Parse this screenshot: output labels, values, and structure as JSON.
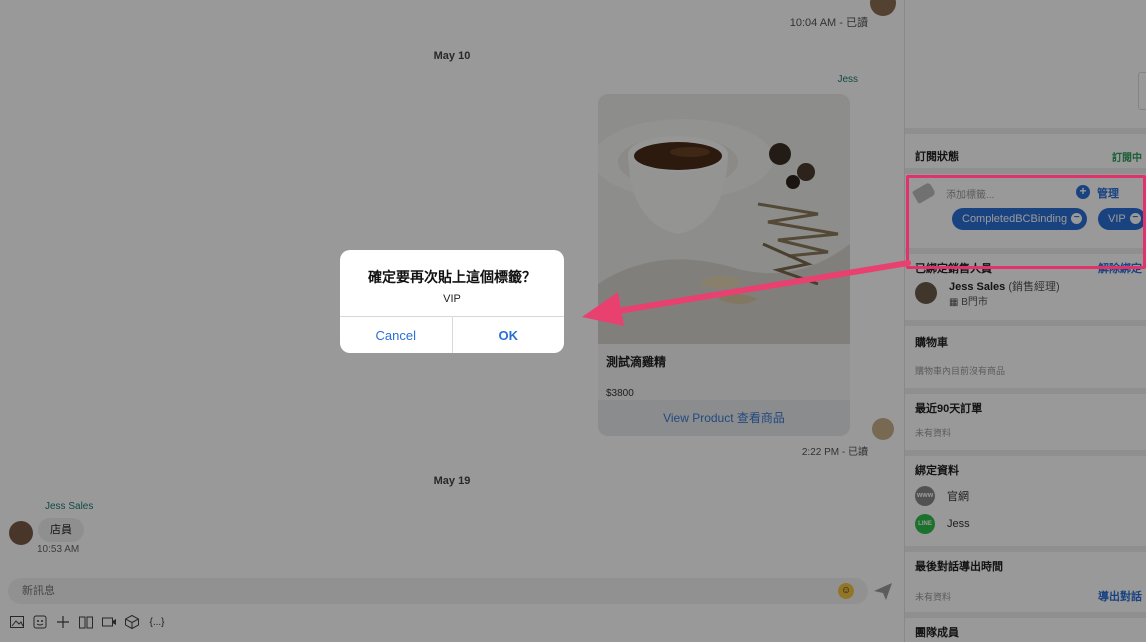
{
  "chat": {
    "top_meta": "10:04 AM - 已讀",
    "date_1": "May 10",
    "sender_right": "Jess",
    "product": {
      "name": "測試滴雞精",
      "price": "$3800",
      "link_label": "View Product 查看商品"
    },
    "sent_meta": "2:22 PM - 已讀",
    "date_2": "May 19",
    "agent_name": "Jess Sales",
    "agent_message": "店員",
    "agent_time": "10:53 AM",
    "composer_placeholder": "新訊息",
    "toolbar_icons": [
      "image-icon",
      "sticker-icon",
      "plus-icon",
      "book-icon",
      "video-icon",
      "box-icon",
      "variable-icon"
    ],
    "variable_label": "{...}"
  },
  "panel": {
    "subscription": {
      "title": "訂閱狀態",
      "status": "訂閱中",
      "status_color": "#2f9d5b"
    },
    "tags": {
      "placeholder": "添加標籤...",
      "manage": "管理",
      "chips": [
        "CompletedBCBinding",
        "VIP"
      ],
      "highlight_color": "#e0336b"
    },
    "sales": {
      "title": "已綁定銷售人員",
      "action": "解除綁定",
      "name": "Jess Sales",
      "role": "(銷售經理)",
      "store": "B門市"
    },
    "cart": {
      "title": "購物車",
      "empty": "購物車內目前沒有商品"
    },
    "orders": {
      "title": "最近90天訂單",
      "empty": "未有資料"
    },
    "binding": {
      "title": "綁定資料",
      "items": [
        {
          "icon": "www-icon",
          "badge": "www",
          "label": "官網"
        },
        {
          "icon": "line-icon",
          "badge": "LINE",
          "label": "Jess"
        }
      ]
    },
    "export": {
      "title": "最後對話導出時間",
      "empty": "未有資料",
      "action": "導出對話"
    },
    "team": {
      "title": "團隊成員"
    }
  },
  "dialog": {
    "title": "確定要再次貼上這個標籤？",
    "message": "VIP",
    "cancel": "Cancel",
    "ok": "OK"
  },
  "accent_color": "#2a6fd6",
  "annotation_arrow_color": "#e8406f"
}
